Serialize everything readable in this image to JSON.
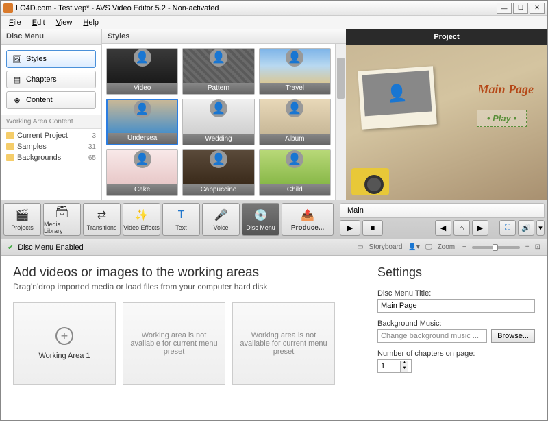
{
  "window": {
    "title": "LO4D.com - Test.vep* - AVS Video Editor 5.2 - Non-activated"
  },
  "menu": {
    "file": "File",
    "edit": "Edit",
    "view": "View",
    "help": "Help"
  },
  "sidebar": {
    "header": "Disc Menu",
    "btn_styles": "Styles",
    "btn_chapters": "Chapters",
    "btn_content": "Content",
    "wa_header": "Working Area Content",
    "items": [
      {
        "label": "Current Project",
        "count": "3"
      },
      {
        "label": "Samples",
        "count": "31"
      },
      {
        "label": "Backgrounds",
        "count": "65"
      }
    ]
  },
  "styles": {
    "header": "Styles",
    "thumbs": [
      "Video",
      "Pattern",
      "Travel",
      "Undersea",
      "Wedding",
      "Album",
      "Cake",
      "Cappuccino",
      "Child"
    ]
  },
  "preview": {
    "header": "Project",
    "title": "Main Page",
    "play": "• Play •",
    "tab": "Main"
  },
  "toolbar": {
    "projects": "Projects",
    "media": "Media Library",
    "transitions": "Transitions",
    "effects": "Video Effects",
    "text": "Text",
    "voice": "Voice",
    "disc": "Disc Menu",
    "produce": "Produce..."
  },
  "status": {
    "enabled": "Disc Menu Enabled",
    "storyboard": "Storyboard",
    "zoom": "Zoom:"
  },
  "lower": {
    "heading": "Add videos or images to the working areas",
    "sub": "Drag'n'drop imported media or load files from your computer hard disk",
    "area1": "Working Area 1",
    "area_na": "Working area is not available for current menu preset"
  },
  "settings": {
    "heading": "Settings",
    "title_lbl": "Disc Menu Title:",
    "title_val": "Main Page",
    "music_lbl": "Background Music:",
    "music_val": "Change background music ...",
    "browse": "Browse...",
    "chapters_lbl": "Number of chapters on page:",
    "chapters_val": "1"
  },
  "watermark": "LO4D.com"
}
